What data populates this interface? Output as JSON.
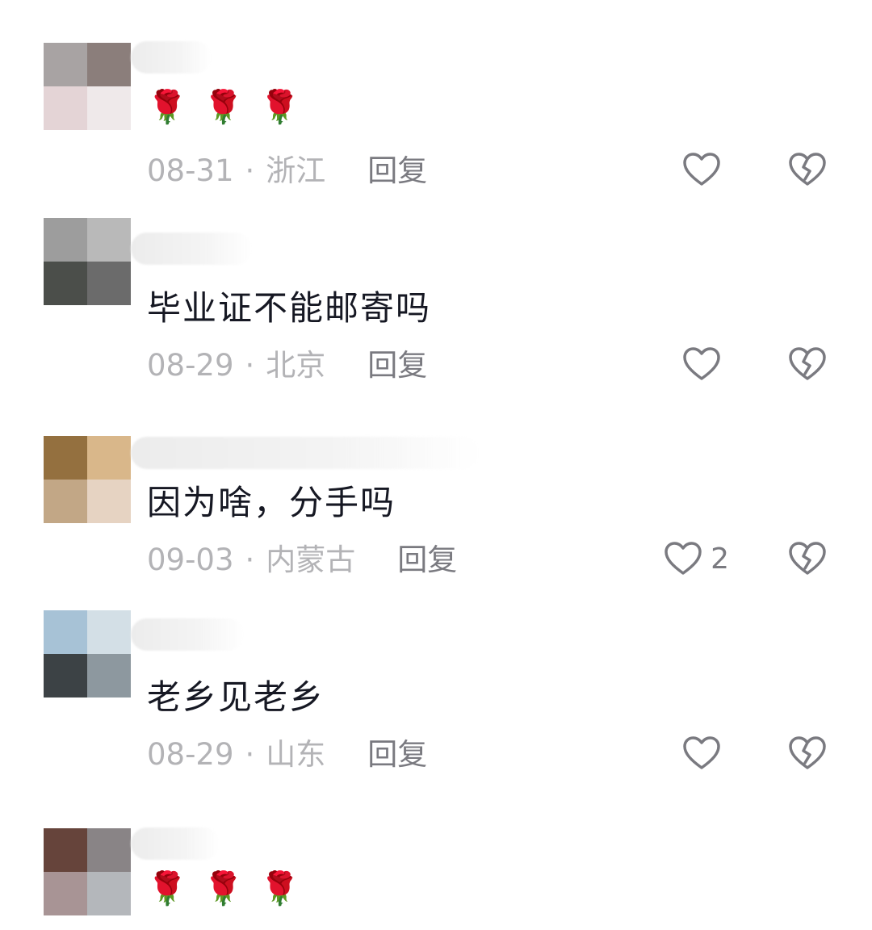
{
  "comments": [
    {
      "avatar_colors": [
        "#a8a3a3",
        "#8b7e7b",
        "#e4d4d6",
        "#efe9ea"
      ],
      "content": "🌹🌹🌹",
      "date": "08-31",
      "separator": "·",
      "region": "浙江",
      "reply_label": "回复",
      "likes": ""
    },
    {
      "avatar_colors": [
        "#9d9d9d",
        "#b9b9b9",
        "#4b4e4a",
        "#6b6b6b"
      ],
      "content": "毕业证不能邮寄吗",
      "date": "08-29",
      "separator": "·",
      "region": "北京",
      "reply_label": "回复",
      "likes": ""
    },
    {
      "avatar_colors": [
        "#94703f",
        "#d9b78a",
        "#c2a786",
        "#e6d3c2"
      ],
      "content": "因为啥，分手吗",
      "date": "09-03",
      "separator": "·",
      "region": "内蒙古",
      "reply_label": "回复",
      "likes": "2"
    },
    {
      "avatar_colors": [
        "#a7c2d6",
        "#d3dfe6",
        "#3c4245",
        "#8d989f"
      ],
      "content": "老乡见老乡",
      "date": "08-29",
      "separator": "·",
      "region": "山东",
      "reply_label": "回复",
      "likes": ""
    },
    {
      "avatar_colors": [
        "#66443b",
        "#898486",
        "#a89495",
        "#b4b7bb"
      ],
      "content": "🌹🌹🌹",
      "date": "",
      "separator": "",
      "region": "",
      "reply_label": "",
      "likes": ""
    }
  ],
  "icons": {
    "like": "heart-outline-icon",
    "dislike": "broken-heart-icon"
  },
  "colors": {
    "text": "#161823",
    "meta": "#b3b3b6",
    "reply": "#7a7a80",
    "icon": "#7a7a80"
  }
}
